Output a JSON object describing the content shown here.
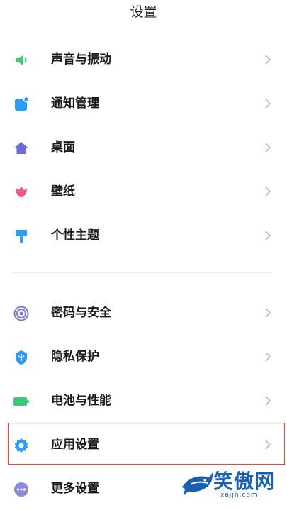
{
  "header": {
    "title": "设置"
  },
  "settings": {
    "items": [
      {
        "label": "声音与振动",
        "icon": "speaker-icon",
        "color": "#3cc97b"
      },
      {
        "label": "通知管理",
        "icon": "notification-icon",
        "color": "#2f9cf0"
      },
      {
        "label": "桌面",
        "icon": "home-icon",
        "color": "#6a6ad8"
      },
      {
        "label": "壁纸",
        "icon": "tulip-icon",
        "color": "#f05a7e"
      },
      {
        "label": "个性主题",
        "icon": "paintbrush-icon",
        "color": "#2f9cf0"
      },
      {
        "label": "密码与安全",
        "icon": "fingerprint-icon",
        "color": "#7b7bd6"
      },
      {
        "label": "隐私保护",
        "icon": "shield-icon",
        "color": "#2f9cf0"
      },
      {
        "label": "电池与性能",
        "icon": "battery-icon",
        "color": "#3cc97b"
      },
      {
        "label": "应用设置",
        "icon": "gear-icon",
        "color": "#2f9cf0"
      },
      {
        "label": "更多设置",
        "icon": "more-dots-icon",
        "color": "#8a8ad8"
      }
    ]
  },
  "watermark": {
    "text": "笑傲网",
    "url": "xajjn.com"
  },
  "colors": {
    "highlight": "#d9473b",
    "chevron": "#bdbdbd"
  }
}
